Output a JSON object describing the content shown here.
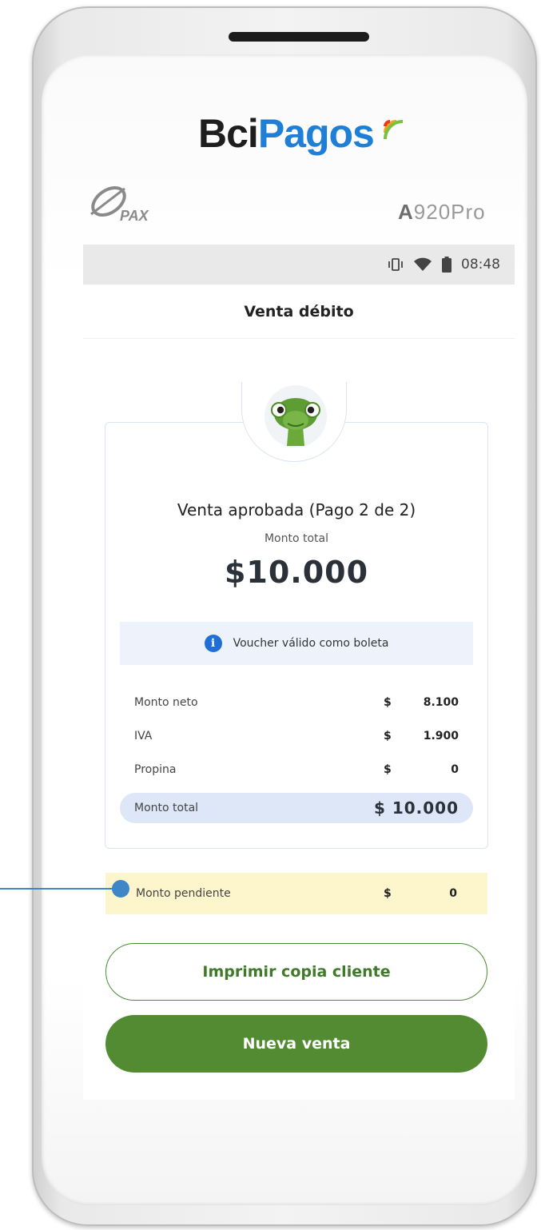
{
  "device": {
    "brand_part1": "Bci",
    "brand_part2": "Pagos",
    "manufacturer_logo": "PAX",
    "model_prefix": "A",
    "model_suffix": "920Pro"
  },
  "status_bar": {
    "time": "08:48",
    "icons": [
      "vibrate-icon",
      "wifi-icon",
      "battery-icon"
    ]
  },
  "app_bar": {
    "title": "Venta débito"
  },
  "receipt": {
    "mascot": "turtle-mascot-icon",
    "title": "Venta aprobada (Pago 2 de 2)",
    "total_label": "Monto total",
    "total_amount": "$10.000",
    "info_text": "Voucher válido como boleta",
    "rows": [
      {
        "label": "Monto neto",
        "currency": "$",
        "value": "8.100"
      },
      {
        "label": "IVA",
        "currency": "$",
        "value": "1.900"
      },
      {
        "label": "Propina",
        "currency": "$",
        "value": "0"
      }
    ],
    "total_row": {
      "label": "Monto total",
      "value": "$ 10.000"
    }
  },
  "pending": {
    "label": "Monto pendiente",
    "currency": "$",
    "value": "0"
  },
  "buttons": {
    "print_copy": "Imprimir copia cliente",
    "new_sale": "Nueva venta"
  },
  "colors": {
    "accent_green": "#538b33",
    "brand_blue": "#1f7fd6",
    "info_blue": "#1f6fd6",
    "pending_bg": "#fdf5cc",
    "annotation": "#3f86c6"
  }
}
